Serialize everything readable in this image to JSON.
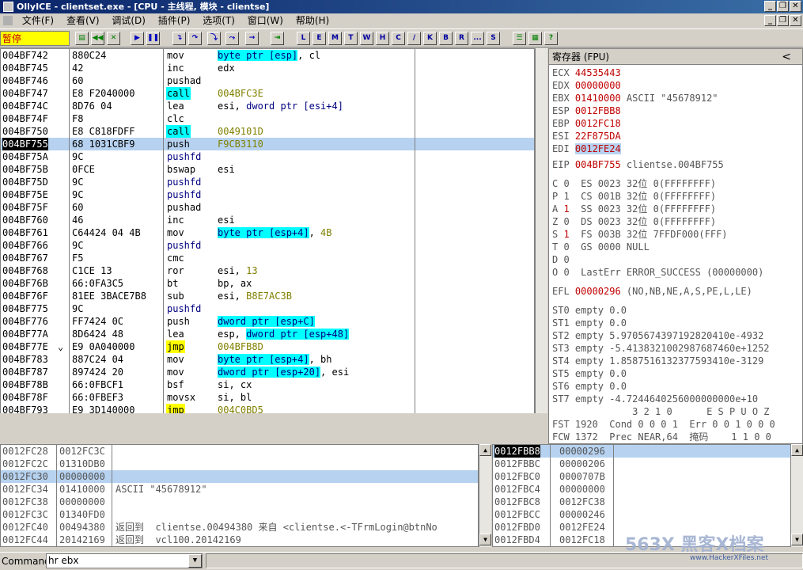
{
  "window": {
    "title": "OllyICE - clientset.exe - [CPU - 主线程, 模块 - clientse]",
    "min": "_",
    "max": "❐",
    "close": "✕"
  },
  "menu": [
    "文件(F)",
    "查看(V)",
    "调试(D)",
    "插件(P)",
    "选项(T)",
    "窗口(W)",
    "帮助(H)"
  ],
  "menu_right": {
    "min": "_",
    "max": "❐",
    "close": "✕"
  },
  "toolbar": {
    "status": "暂停",
    "letters": [
      "L",
      "E",
      "M",
      "T",
      "W",
      "H",
      "C",
      "/",
      "K",
      "B",
      "R",
      "...",
      "S"
    ]
  },
  "disasm": [
    {
      "addr": "004BF742",
      "hex": "880C24",
      "mn": "mov",
      "op": [
        {
          "t": "byte ptr [esp]",
          "c": "mem"
        },
        {
          "t": ", cl"
        }
      ]
    },
    {
      "addr": "004BF745",
      "hex": "42",
      "mn": "inc",
      "op": [
        {
          "t": "edx"
        }
      ]
    },
    {
      "addr": "004BF746",
      "hex": "60",
      "mn": "pushad",
      "op": []
    },
    {
      "addr": "004BF747",
      "hex": "E8 F2040000",
      "mn": "call",
      "mc": "call",
      "op": [
        {
          "t": "004BFC3E",
          "c": "imm"
        }
      ]
    },
    {
      "addr": "004BF74C",
      "hex": "8D76 04",
      "mn": "lea",
      "op": [
        {
          "t": "esi, "
        },
        {
          "t": "dword ptr [esi+4]",
          "c": "memt"
        }
      ]
    },
    {
      "addr": "004BF74F",
      "hex": "F8",
      "mn": "clc",
      "op": []
    },
    {
      "addr": "004BF750",
      "hex": "E8 C818FDFF",
      "mn": "call",
      "mc": "call",
      "op": [
        {
          "t": "0049101D",
          "c": "imm"
        }
      ]
    },
    {
      "addr": "004BF755",
      "hex": "68 1031CBF9",
      "mn": "push",
      "op": [
        {
          "t": "F9CB3110",
          "c": "imm"
        }
      ],
      "sel": true
    },
    {
      "addr": "004BF75A",
      "hex": "9C",
      "mn": "pushfd",
      "mc": "pf",
      "op": []
    },
    {
      "addr": "004BF75B",
      "hex": "0FCE",
      "mn": "bswap",
      "op": [
        {
          "t": "esi"
        }
      ]
    },
    {
      "addr": "004BF75D",
      "hex": "9C",
      "mn": "pushfd",
      "mc": "pf",
      "op": []
    },
    {
      "addr": "004BF75E",
      "hex": "9C",
      "mn": "pushfd",
      "mc": "pf",
      "op": []
    },
    {
      "addr": "004BF75F",
      "hex": "60",
      "mn": "pushad",
      "op": []
    },
    {
      "addr": "004BF760",
      "hex": "46",
      "mn": "inc",
      "op": [
        {
          "t": "esi"
        }
      ]
    },
    {
      "addr": "004BF761",
      "hex": "C64424 04 4B",
      "mn": "mov",
      "op": [
        {
          "t": "byte ptr [esp+4]",
          "c": "mem"
        },
        {
          "t": ", "
        },
        {
          "t": "4B",
          "c": "imm"
        }
      ]
    },
    {
      "addr": "004BF766",
      "hex": "9C",
      "mn": "pushfd",
      "mc": "pf",
      "op": []
    },
    {
      "addr": "004BF767",
      "hex": "F5",
      "mn": "cmc",
      "op": []
    },
    {
      "addr": "004BF768",
      "hex": "C1CE 13",
      "mn": "ror",
      "op": [
        {
          "t": "esi, "
        },
        {
          "t": "13",
          "c": "imm"
        }
      ]
    },
    {
      "addr": "004BF76B",
      "hex": "66:0FA3C5",
      "mn": "bt",
      "op": [
        {
          "t": "bp, ax"
        }
      ]
    },
    {
      "addr": "004BF76F",
      "hex": "81EE 3BACE7B8",
      "mn": "sub",
      "op": [
        {
          "t": "esi, "
        },
        {
          "t": "B8E7AC3B",
          "c": "imm"
        }
      ]
    },
    {
      "addr": "004BF775",
      "hex": "9C",
      "mn": "pushfd",
      "mc": "pf",
      "op": []
    },
    {
      "addr": "004BF776",
      "hex": "FF7424 0C",
      "mn": "push",
      "op": [
        {
          "t": "dword ptr [esp+C]",
          "c": "mem"
        }
      ]
    },
    {
      "addr": "004BF77A",
      "hex": "8D6424 48",
      "mn": "lea",
      "op": [
        {
          "t": "esp, "
        },
        {
          "t": "dword ptr [esp+48]",
          "c": "mem"
        }
      ]
    },
    {
      "addr": "004BF77E",
      "hex": "E9 0A040000",
      "mn": "jmp",
      "mc": "jmp",
      "op": [
        {
          "t": "004BFB8D",
          "c": "imm"
        }
      ],
      "mark": "⌄"
    },
    {
      "addr": "004BF783",
      "hex": "887C24 04",
      "mn": "mov",
      "op": [
        {
          "t": "byte ptr [esp+4]",
          "c": "mem"
        },
        {
          "t": ", bh"
        }
      ]
    },
    {
      "addr": "004BF787",
      "hex": "897424 20",
      "mn": "mov",
      "op": [
        {
          "t": "dword ptr [esp+20]",
          "c": "mem"
        },
        {
          "t": ", esi"
        }
      ]
    },
    {
      "addr": "004BF78B",
      "hex": "66:0FBCF1",
      "mn": "bsf",
      "op": [
        {
          "t": "si, cx"
        }
      ]
    },
    {
      "addr": "004BF78F",
      "hex": "66:0FBEF3",
      "mn": "movsx",
      "op": [
        {
          "t": "si, bl"
        }
      ]
    },
    {
      "addr": "004BF793",
      "hex": "E9 3D140000",
      "mn": "jmp",
      "mc": "jmp",
      "op": [
        {
          "t": "004C0BD5",
          "c": "imm"
        }
      ]
    }
  ],
  "registers": {
    "title": "寄存器 (FPU)",
    "collapse": "<",
    "gp": [
      {
        "n": "ECX",
        "v": "44535443",
        "x": ""
      },
      {
        "n": "EDX",
        "v": "00000000",
        "x": ""
      },
      {
        "n": "EBX",
        "v": "01410000",
        "x": "ASCII \"45678912\""
      },
      {
        "n": "ESP",
        "v": "0012FBB8",
        "x": ""
      },
      {
        "n": "EBP",
        "v": "0012FC18",
        "x": ""
      },
      {
        "n": "ESI",
        "v": "22F875DA",
        "x": ""
      },
      {
        "n": "EDI",
        "v": "0012FE24",
        "x": "",
        "sel": true
      }
    ],
    "eip": {
      "n": "EIP",
      "v": "004BF755",
      "x": "clientse.004BF755"
    },
    "flags": [
      {
        "f": "C",
        "b": "0",
        "s": "ES 0023 32位 0(FFFFFFFF)"
      },
      {
        "f": "P",
        "b": "1",
        "s": "CS 001B 32位 0(FFFFFFFF)"
      },
      {
        "f": "A",
        "b": "1",
        "s": "SS 0023 32位 0(FFFFFFFF)",
        "red": true
      },
      {
        "f": "Z",
        "b": "0",
        "s": "DS 0023 32位 0(FFFFFFFF)"
      },
      {
        "f": "S",
        "b": "1",
        "s": "FS 003B 32位 7FFDF000(FFF)",
        "red": true
      },
      {
        "f": "T",
        "b": "0",
        "s": "GS 0000 NULL"
      },
      {
        "f": "D",
        "b": "0",
        "s": ""
      },
      {
        "f": "O",
        "b": "0",
        "s": "LastErr ERROR_SUCCESS (00000000)"
      }
    ],
    "efl": {
      "n": "EFL",
      "v": "00000296",
      "x": "(NO,NB,NE,A,S,PE,L,LE)"
    },
    "fpu": [
      "ST0 empty 0.0",
      "ST1 empty 0.0",
      "ST2 empty 5.9705674397192820410e-4932",
      "ST3 empty -5.4138321002987687460e+1252",
      "ST4 empty 1.8587516132377593410e-3129",
      "ST5 empty 0.0",
      "ST6 empty 0.0",
      "ST7 empty -4.7244640256000000000e+10"
    ],
    "fpu_hdr": "              3 2 1 0      E S P U O Z",
    "fst": "FST 1920  Cond 0 0 0 1  Err 0 0 1 0 0 0",
    "fcw": "FCW 1372  Prec NEAR,64  掩码    1 1 0 0"
  },
  "dump": [
    {
      "a": "0012FC28",
      "v": "0012FC3C",
      "c": ""
    },
    {
      "a": "0012FC2C",
      "v": "01310DB0",
      "c": ""
    },
    {
      "a": "0012FC30",
      "v": "00000000",
      "c": "",
      "sel": true
    },
    {
      "a": "0012FC34",
      "v": "01410000",
      "c": "ASCII \"45678912\""
    },
    {
      "a": "0012FC38",
      "v": "00000000",
      "c": ""
    },
    {
      "a": "0012FC3C",
      "v": "01340FD0",
      "c": ""
    },
    {
      "a": "0012FC40",
      "v": "00494380",
      "c": "返回到  clientse.00494380 来自 <clientse.<-TFrmLogin@btnNo"
    },
    {
      "a": "0012FC44",
      "v": "20142169",
      "c": "返回到  vcl100.20142169"
    }
  ],
  "stack": [
    {
      "a": "0012FBB8",
      "v": "00000296",
      "top": true
    },
    {
      "a": "0012FBBC",
      "v": "00000206"
    },
    {
      "a": "0012FBC0",
      "v": "0000707B"
    },
    {
      "a": "0012FBC4",
      "v": "00000000"
    },
    {
      "a": "0012FBC8",
      "v": "0012FC38"
    },
    {
      "a": "0012FBCC",
      "v": "00000246"
    },
    {
      "a": "0012FBD0",
      "v": "0012FE24"
    },
    {
      "a": "0012FBD4",
      "v": "0012FC18"
    }
  ],
  "command": {
    "label": "Command",
    "value": "hr ebx",
    "drop": "▼"
  },
  "watermark": {
    "brand": "563X 黑客X档案",
    "site": "www.HackerXFiles.net"
  },
  "colors": {
    "accent": "#0a246a",
    "status": "#ffff00",
    "call": "#00ffff",
    "jmp": "#ffff00",
    "reg_changed": "#c00000"
  }
}
